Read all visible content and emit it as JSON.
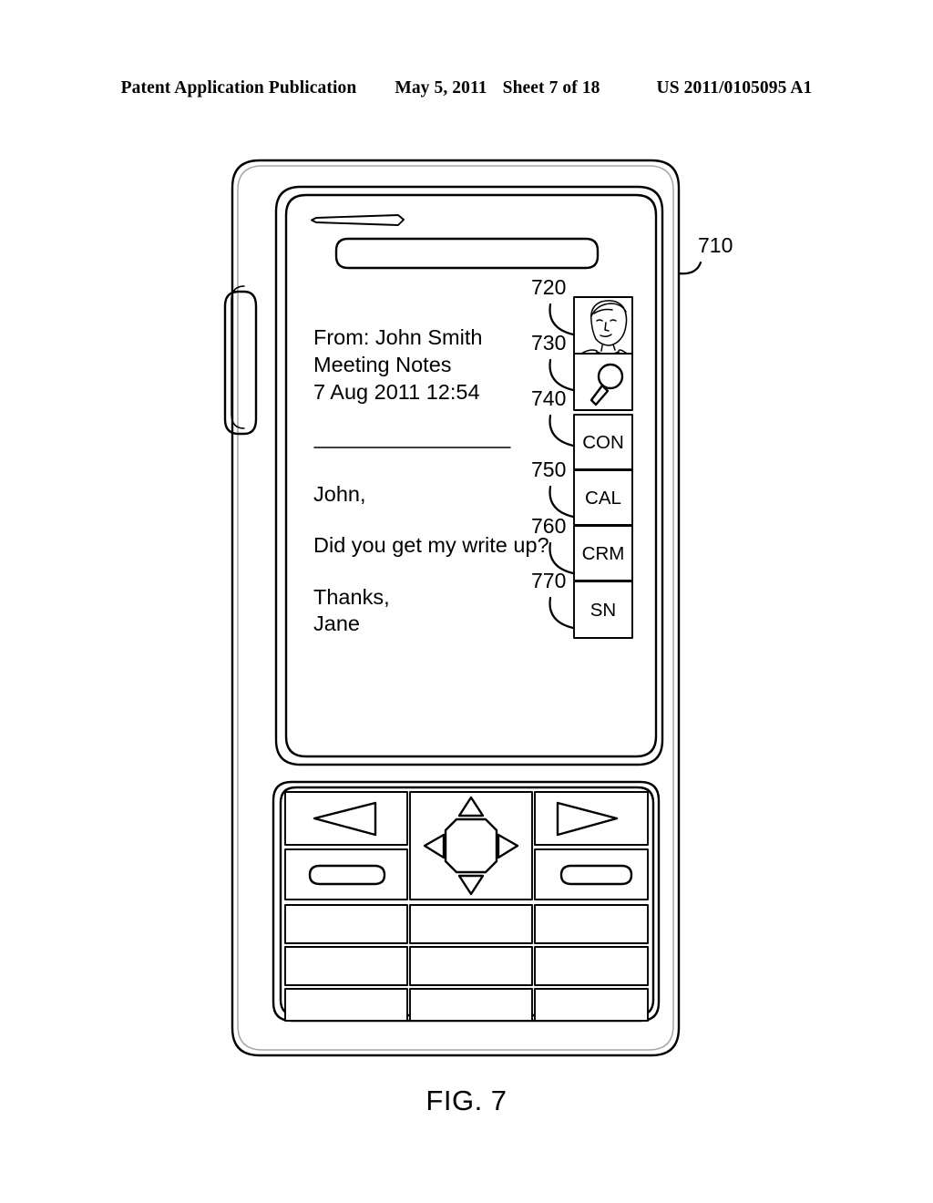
{
  "page_header": {
    "publication": "Patent Application Publication",
    "date": "May 5, 2011",
    "sheet": "Sheet 7 of 18",
    "patent_number": "US 2011/0105095 A1"
  },
  "figure": {
    "caption": "FIG. 7",
    "device_reference": "710"
  },
  "device": {
    "screen": {
      "email": {
        "from_line": "From: John Smith",
        "subject_line": "Meeting Notes",
        "date_line": "7 Aug 2011 12:54",
        "body_lines": [
          "John,",
          "Did you get my write up?",
          "Thanks,",
          "Jane"
        ]
      },
      "action_strip": {
        "items": [
          {
            "ref": "720",
            "label": "",
            "icon": "contact-portrait-icon",
            "type": "icon"
          },
          {
            "ref": "730",
            "label": "",
            "icon": "magnifier-icon",
            "type": "icon"
          },
          {
            "ref": "740",
            "label": "CON",
            "icon": "",
            "type": "text"
          },
          {
            "ref": "750",
            "label": "CAL",
            "icon": "",
            "type": "text"
          },
          {
            "ref": "760",
            "label": "CRM",
            "icon": "",
            "type": "text"
          },
          {
            "ref": "770",
            "label": "SN",
            "icon": "",
            "type": "text"
          }
        ]
      }
    }
  },
  "colors": {
    "ink": "#000000",
    "paper": "#ffffff"
  }
}
